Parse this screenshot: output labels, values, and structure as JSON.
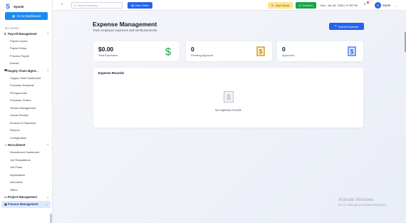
{
  "brand": {
    "name": "Syncle"
  },
  "sidebar": {
    "goto_label": "Go to Dashboard",
    "section_label": "MY WORK",
    "groups": [
      {
        "label": "Payroll Management",
        "icon": "dollar-icon",
        "items": [
          "Payroll Cycles",
          "Payroll Setup",
          "Process Payroll",
          "Arrears"
        ]
      },
      {
        "label": "Supply Chain Mgmt...",
        "icon": "cart-icon",
        "items": [
          "Supply Chain Dashboard",
          "Purchase Requests",
          "PR Approvals",
          "Purchase Orders",
          "Vendor Management",
          "Goods Receipt",
          "Invoices & Payments",
          "Reports",
          "Configuration"
        ]
      },
      {
        "label": "Recruitment",
        "icon": "users-icon",
        "items": [
          "Recruitment Dashboard",
          "Job Requisitions",
          "Job Posts",
          "Applications",
          "Interviews",
          "Offers"
        ]
      },
      {
        "label": "Project Management",
        "icon": "folder-icon",
        "items": []
      },
      {
        "label": "Finance Management",
        "icon": "briefcase-icon",
        "items": []
      }
    ]
  },
  "topbar": {
    "search_placeholder": "Search Anything...",
    "new_ticket_label": "New Ticket",
    "mark_break_label": "Mark Break",
    "checkin_label": "Check-in",
    "datetime": "Mon, Jan 26, 2026 | 07:59 PM",
    "avatar_initial": "S",
    "username": "Sarah"
  },
  "page": {
    "title": "Expense Management",
    "subtitle": "Track employee expenses and reimbursements",
    "submit_label": "Submit Expense"
  },
  "stats": [
    {
      "value": "$0.00",
      "label": "Total Expenses",
      "icon": "dollar-sign-icon",
      "color": "#16a34a"
    },
    {
      "value": "0",
      "label": "Pending Approval",
      "icon": "receipt-icon",
      "color": "#ca8a04"
    },
    {
      "value": "0",
      "label": "Approved",
      "icon": "receipt-icon",
      "color": "#2563eb"
    }
  ],
  "records": {
    "title": "Expense Records",
    "empty_text": "No expense records"
  },
  "watermark": {
    "line1": "Activate Windows",
    "line2": "Go to Settings to activate Windows."
  },
  "colors": {
    "primary": "#2563eb",
    "success": "#16a34a",
    "warning_bg": "#fde68a",
    "sidebar_active_bg": "#dbeafe"
  }
}
